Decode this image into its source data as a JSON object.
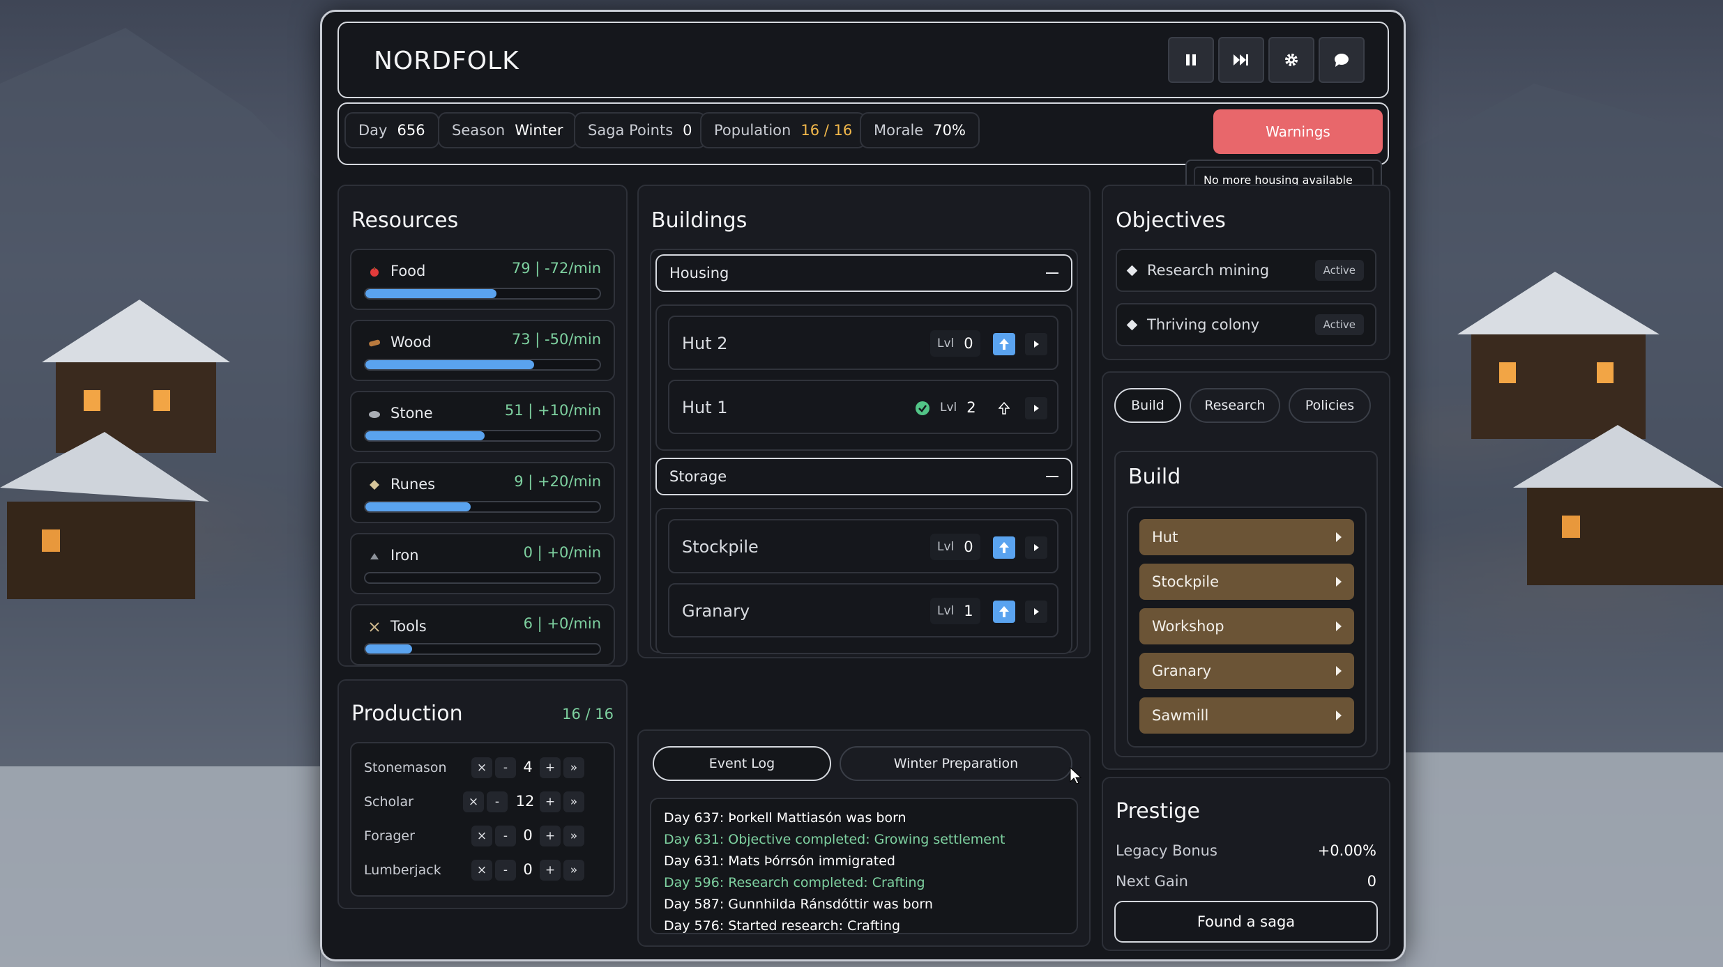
{
  "header": {
    "title": "NORDFOLK"
  },
  "stats": [
    {
      "label": "Day",
      "value": "656"
    },
    {
      "label": "Season",
      "value": "Winter"
    },
    {
      "label": "Saga Points",
      "value": "0"
    },
    {
      "label": "Population",
      "value": "16 / 16"
    },
    {
      "label": "Morale",
      "value": "70%"
    }
  ],
  "warnings": {
    "label": "Warnings",
    "tooltip": "No more housing available"
  },
  "resources": {
    "title": "Resources",
    "items": [
      {
        "name": "Food",
        "value": "79 | -72/min",
        "fill": 0.56,
        "icon": "apple-icon"
      },
      {
        "name": "Wood",
        "value": "73 | -50/min",
        "fill": 0.72,
        "icon": "log-icon"
      },
      {
        "name": "Stone",
        "value": "51 | +10/min",
        "fill": 0.51,
        "icon": "stone-icon"
      },
      {
        "name": "Runes",
        "value": "9 | +20/min",
        "fill": 0.45,
        "icon": "rune-icon"
      },
      {
        "name": "Iron",
        "value": "0 | +0/min",
        "fill": 0.0,
        "icon": "iron-icon"
      },
      {
        "name": "Tools",
        "value": "6 | +0/min",
        "fill": 0.2,
        "icon": "tools-icon"
      }
    ]
  },
  "production": {
    "title": "Production",
    "count": "16 / 16",
    "jobs": [
      {
        "name": "Stonemason",
        "value": "4"
      },
      {
        "name": "Scholar",
        "value": "12"
      },
      {
        "name": "Forager",
        "value": "0"
      },
      {
        "name": "Lumberjack",
        "value": "0"
      }
    ],
    "btn_clear": "×",
    "btn_minus": "-",
    "btn_plus": "+",
    "btn_max": "»"
  },
  "buildings": {
    "title": "Buildings",
    "lvl_label": "Lvl",
    "groups": [
      {
        "name": "Housing",
        "items": [
          {
            "name": "Hut 2",
            "level": "0"
          },
          {
            "name": "Hut 1",
            "level": "2"
          }
        ]
      },
      {
        "name": "Storage",
        "items": [
          {
            "name": "Stockpile",
            "level": "0"
          },
          {
            "name": "Granary",
            "level": "1"
          }
        ]
      }
    ]
  },
  "log": {
    "tabs": [
      "Event Log",
      "Winter Preparation"
    ],
    "lines": [
      "Day 637: Þorkell Mattiasón was born",
      "Day 631: Objective completed: Growing settlement",
      "Day 631: Mats Þórrsón immigrated",
      "Day 596: Research completed: Crafting",
      "Day 587: Gunnhilda Ránsdóttir was born",
      "Day 576: Started research: Crafting"
    ]
  },
  "objectives": {
    "title": "Objectives",
    "items": [
      {
        "name": "Research mining",
        "status": "Active"
      },
      {
        "name": "Thriving colony",
        "status": "Active"
      }
    ]
  },
  "action_tabs": [
    "Build",
    "Research",
    "Policies"
  ],
  "build": {
    "title": "Build",
    "items": [
      "Hut",
      "Stockpile",
      "Workshop",
      "Granary",
      "Sawmill"
    ]
  },
  "prestige": {
    "title": "Prestige",
    "legacy_label": "Legacy Bonus",
    "legacy_value": "+0.00%",
    "next_label": "Next Gain",
    "next_value": "0",
    "button": "Found a saga"
  },
  "colors": {
    "accent": "#5aa3ef",
    "good": "#7ed1a0",
    "warn": "#e8676b",
    "build": "#6b5436",
    "pop": "#f2b84b"
  }
}
